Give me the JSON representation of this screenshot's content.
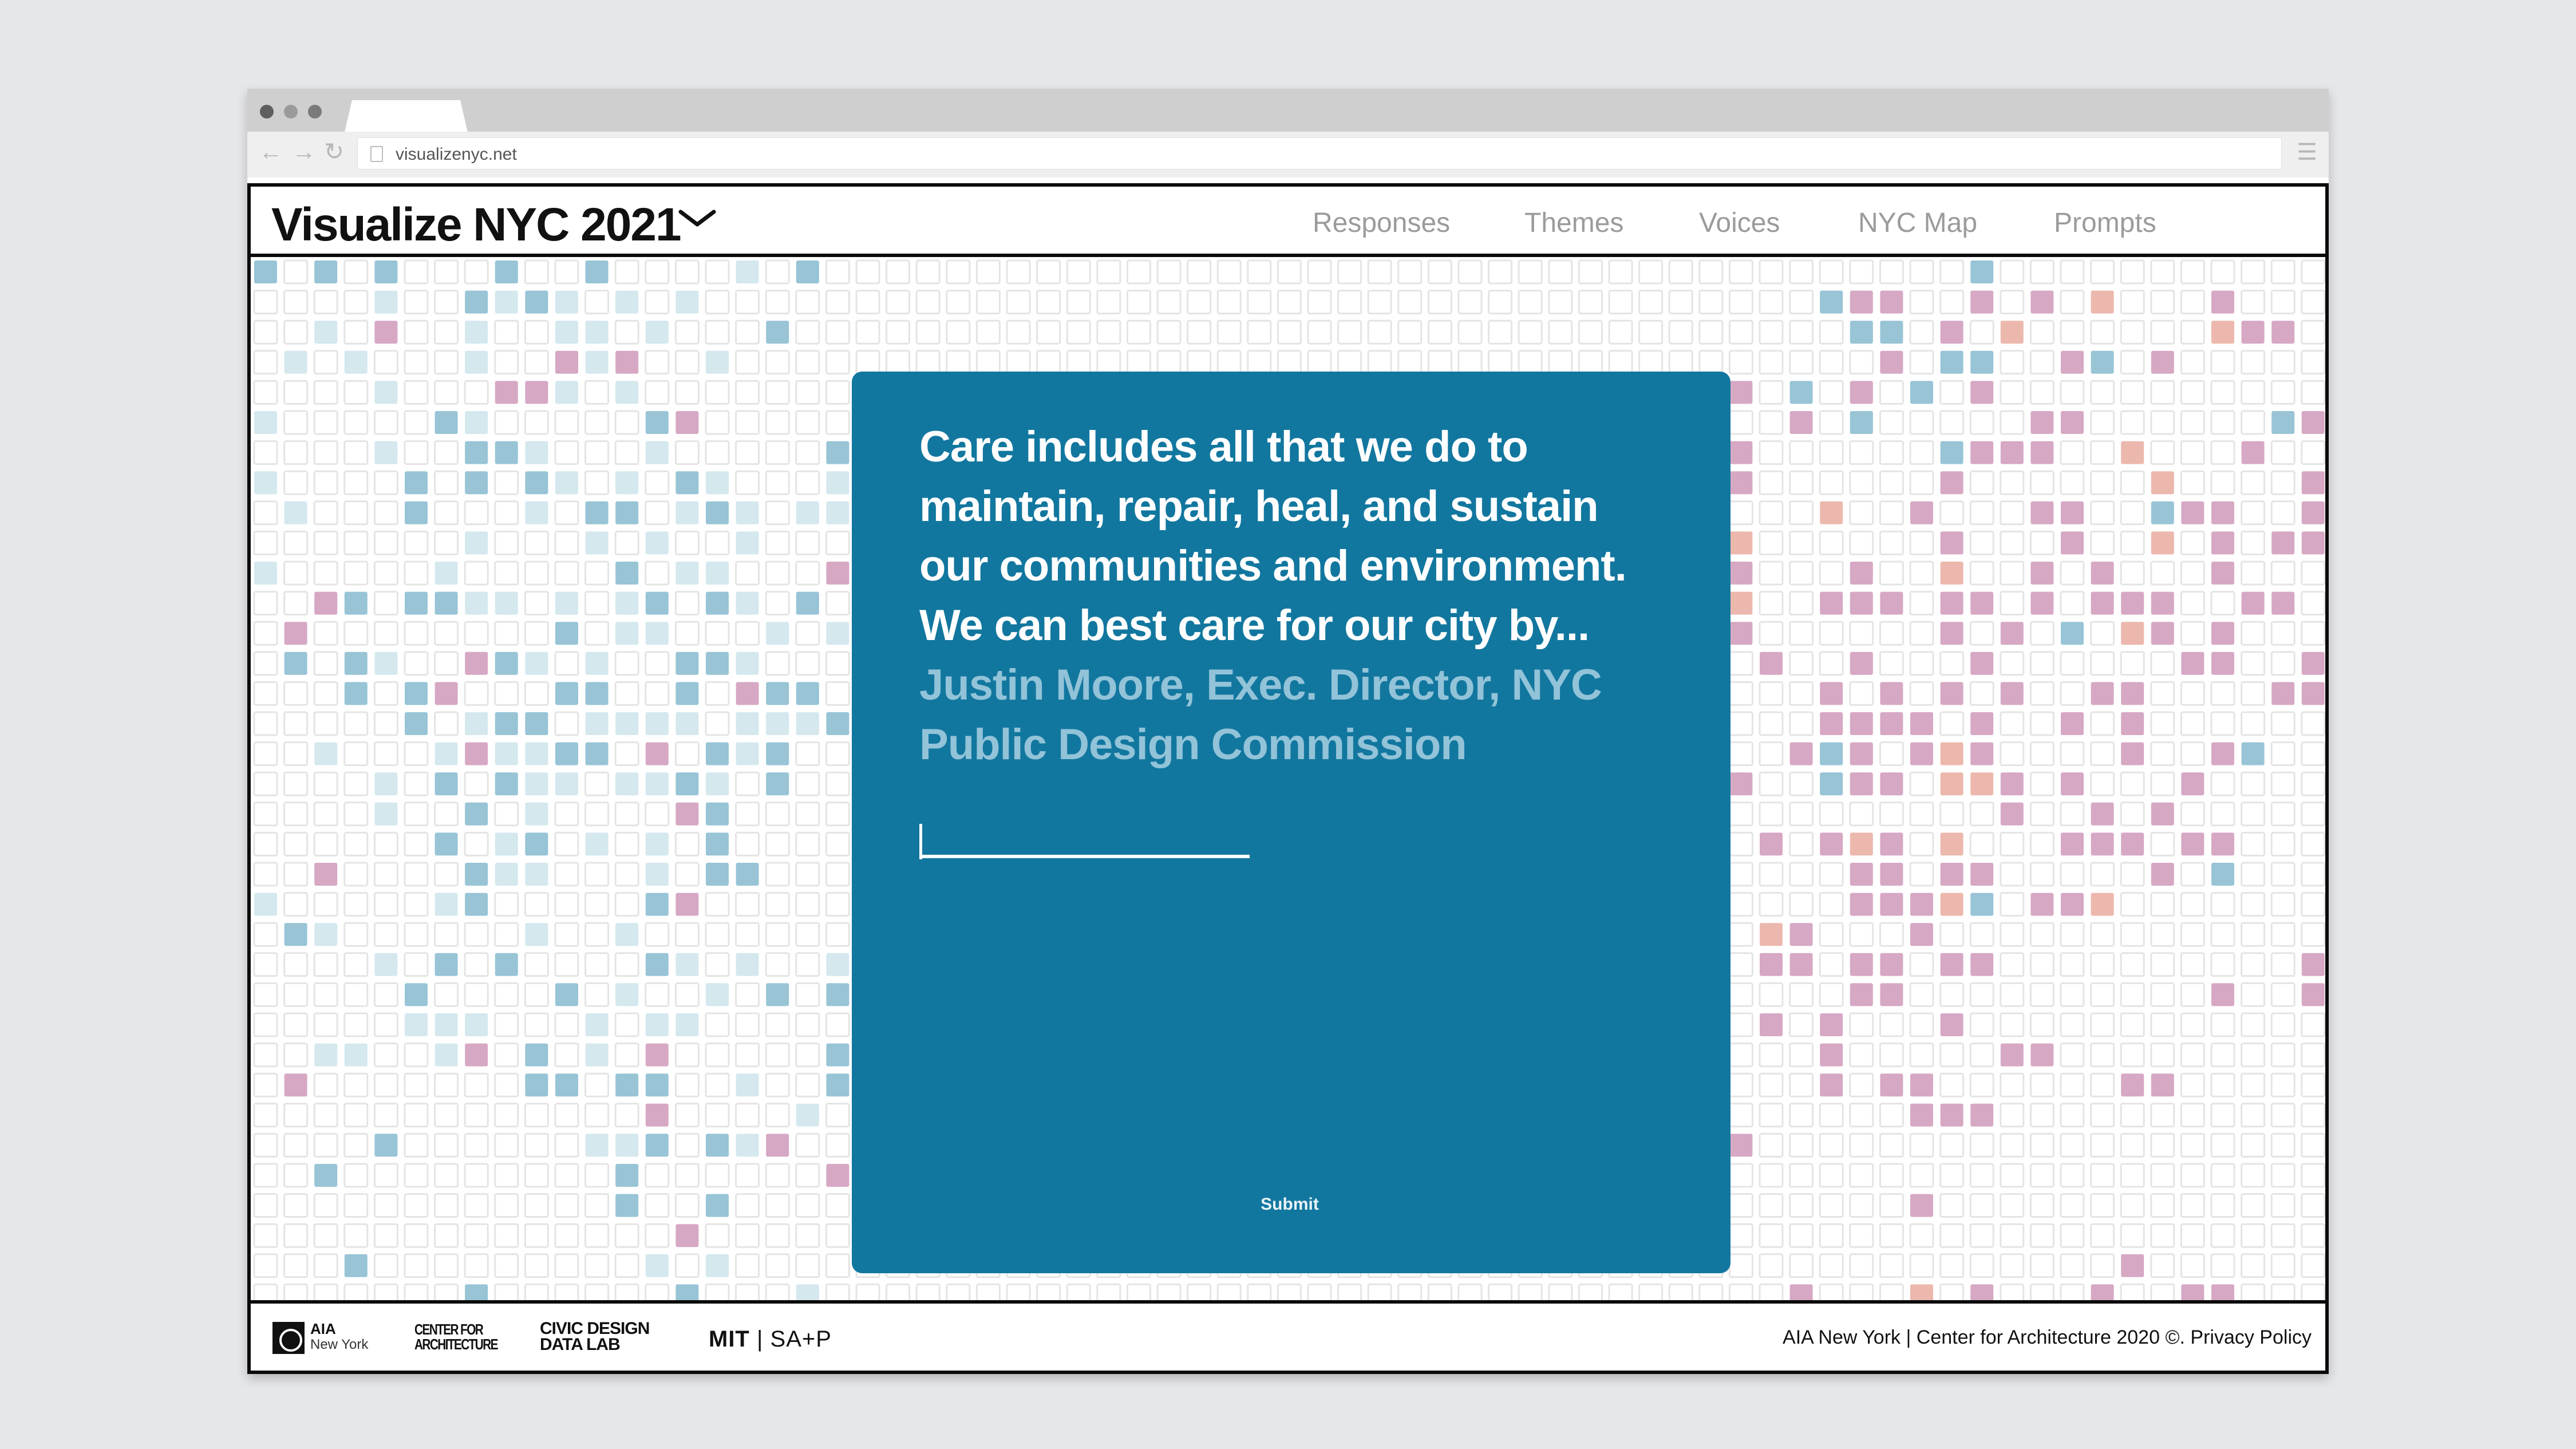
{
  "browser": {
    "url": "visualizenyc.net",
    "back_glyph": "←",
    "forward_glyph": "→",
    "reload_glyph": "↻",
    "menu_glyph": "☰"
  },
  "header": {
    "title": "Visualize NYC 2021",
    "nav": [
      "Responses",
      "Themes",
      "Voices",
      "NYC Map",
      "Prompts"
    ]
  },
  "modal": {
    "prompt_lines": [
      "Care includes all that we do to",
      "maintain, repair, heal, and sustain",
      "our communities and environment.",
      "We can best care for our city by..."
    ],
    "author_lines": [
      "Justin Moore, Exec. Director, NYC",
      "Public  Design Commission"
    ],
    "input_value": "",
    "submit_label": "Submit"
  },
  "footer": {
    "aia_top": "AIA",
    "aia_bottom": "New York",
    "cfa_top": "CENTER FOR",
    "cfa_bottom": "ARCHITECTURE",
    "cdl_top": "CIVIC DESIGN",
    "cdl_bottom": "DATA LAB",
    "mit_mark": "MIT",
    "mit_sep": "|",
    "mit_sap": "SA+P",
    "copyright": "AIA New York | Center for Architecture 2020 ©. Privacy Policy"
  },
  "colors": {
    "modal_bg": "#12779f",
    "author_text": "#92c3d8",
    "cell_outline": "#e4e4e4",
    "light_blue": "#d4e8ee",
    "mid_blue": "#98c4d6",
    "pink": "#d6a8c4",
    "salmon": "#ecb8ad"
  }
}
